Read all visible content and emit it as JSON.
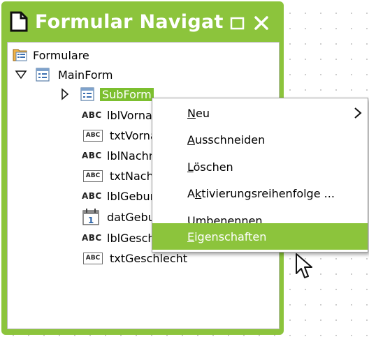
{
  "panel": {
    "title": "Formular Navigator",
    "float_icon": "float-window-icon",
    "close_icon": "close-icon",
    "title_icon": "document-icon"
  },
  "tree": {
    "root": {
      "label": "Formulare",
      "icon": "forms-folder-icon"
    },
    "mainform": {
      "label": "MainForm",
      "icon": "form-icon",
      "expanded": true
    },
    "subform": {
      "label": "SubForm",
      "icon": "form-icon",
      "expanded": false,
      "selected": true
    },
    "controls": [
      {
        "label": "lblVorname",
        "icon": "label-control-icon"
      },
      {
        "label": "txtVorname",
        "icon": "textbox-control-icon"
      },
      {
        "label": "lblNachname",
        "icon": "label-control-icon"
      },
      {
        "label": "txtNachname",
        "icon": "textbox-control-icon"
      },
      {
        "label": "lblGeburtsdatum",
        "icon": "label-control-icon"
      },
      {
        "label": "datGeburtsdatum",
        "icon": "date-control-icon"
      },
      {
        "label": "lblGeschlecht",
        "icon": "label-control-icon"
      },
      {
        "label": "txtGeschlecht",
        "icon": "textbox-control-icon"
      }
    ]
  },
  "context_menu": {
    "items": [
      {
        "label": "Neu",
        "mnemonic": "N",
        "rest": "eu",
        "submenu": true
      },
      {
        "label": "Ausschneiden",
        "mnemonic": "A",
        "rest": "usschneiden"
      },
      {
        "label": "Löschen",
        "mnemonic": "L",
        "rest": "öschen"
      },
      {
        "label": "Aktivierungsreihenfolge ...",
        "pre": "A",
        "mnemonic": "k",
        "rest": "tivierungsreihenfolge ..."
      },
      {
        "label": "Umbenennen",
        "mnemonic": "U",
        "rest": "mbenennen"
      },
      {
        "label": "Eigenschaften",
        "mnemonic": "E",
        "rest": "igenschaften",
        "highlighted": true
      }
    ]
  },
  "colors": {
    "accent": "#8cc43c",
    "selection": "#7cbf2f"
  }
}
